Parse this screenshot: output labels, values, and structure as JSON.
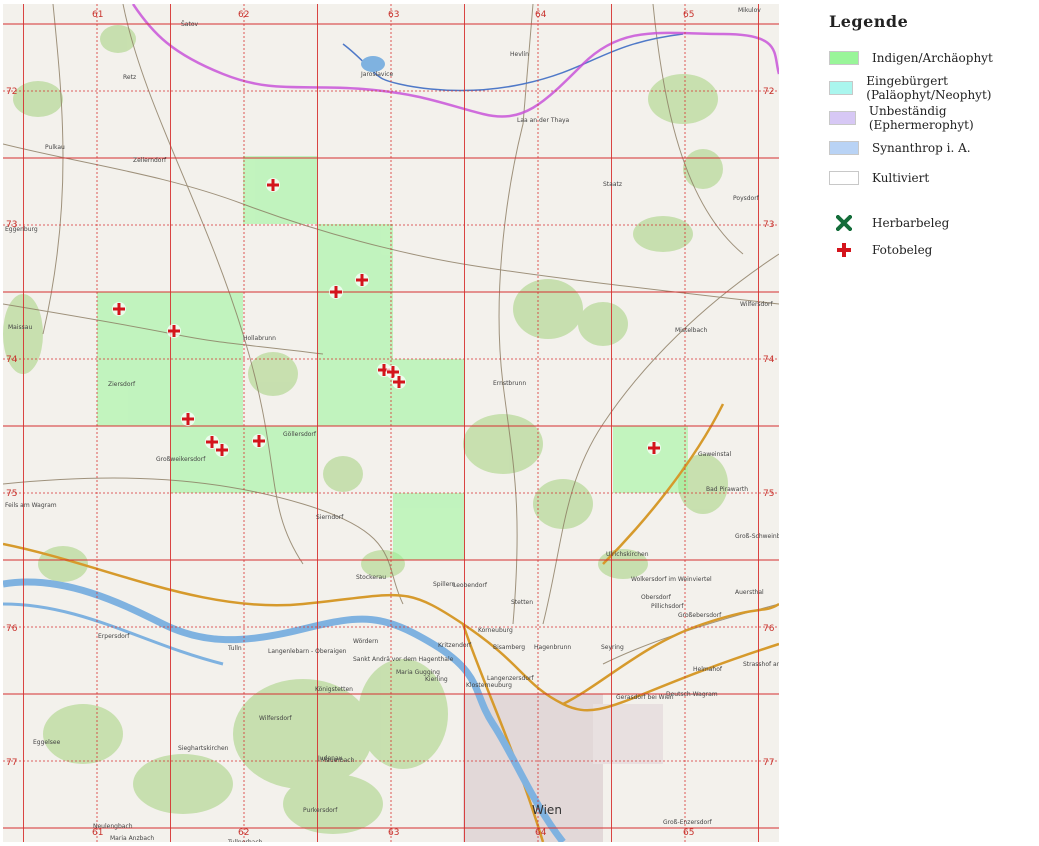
{
  "map": {
    "grid_columns": [
      "61",
      "62",
      "63",
      "64",
      "65"
    ],
    "grid_rows": [
      "72",
      "73",
      "74",
      "75",
      "76",
      "77"
    ],
    "places": [
      "Šatov",
      "Jaroslavice",
      "Mikulov",
      "Hevlín",
      "Laa an der Thaya",
      "Pulkau",
      "Zellerndorf",
      "Retz",
      "Eggenburg",
      "Maissau",
      "Hollabrunn",
      "Poysdorf",
      "Staatz",
      "Wilfersdorf",
      "Mistelbach",
      "Ernstbrunn",
      "Ziersdorf",
      "Göllersdorf",
      "Großweikersdorf",
      "Gaweinstal",
      "Bad Pirawarth",
      "Feils am Wagram",
      "Sierndorf",
      "Stockerau",
      "Spillern",
      "Leobendorf",
      "Ulrichskirchen",
      "Wolkersdorf im Weinviertel",
      "Obersdorf",
      "Pillichsdorf",
      "Großebersdorf",
      "Auersthal",
      "Stetten",
      "Korneuburg",
      "Bisamberg",
      "Hagenbrunn",
      "Seyring",
      "Erpersdorf",
      "Tulln",
      "Langenlebarn - Oberaigen",
      "Wördern",
      "Sankt Andrä vor dem Hagenthale",
      "Kritzendorf",
      "Maria Gugging",
      "Kierling",
      "Klosterneuburg",
      "Langenzersdorf",
      "Gerasdorf bei Wien",
      "Deutsch-Wagram",
      "Strasshof an der Nordbahn",
      "Königstetten",
      "Wilfersdorf",
      "Sieghartskirchen",
      "Judenau",
      "Mauerbach",
      "Purkersdorf",
      "Wien",
      "Groß-Enzersdorf",
      "Neulengbach",
      "Maria Anzbach",
      "Tullnerbach",
      "Eggelsee",
      "Groß-Schweinbarth",
      "Helmahof"
    ],
    "city_label": "Wien"
  },
  "legend": {
    "title": "Legende",
    "status": [
      {
        "label": "Indigen/Archäophyt",
        "color": "#99f599"
      },
      {
        "label": "Eingebürgert (Paläophyt/Neophyt)",
        "color": "#aaf6ee"
      },
      {
        "label": "Unbeständig (Ephermerophyt)",
        "color": "#d7c8f5"
      },
      {
        "label": "Synanthrop i. A.",
        "color": "#b9d3f5"
      },
      {
        "label": "Kultiviert",
        "color": "#ffffff"
      }
    ],
    "evidence": [
      {
        "label": "Herbarbeleg",
        "icon": "green-x-icon",
        "color": "#146d3a"
      },
      {
        "label": "Fotobeleg",
        "icon": "red-plus-icon",
        "color": "#d4141c"
      }
    ]
  }
}
